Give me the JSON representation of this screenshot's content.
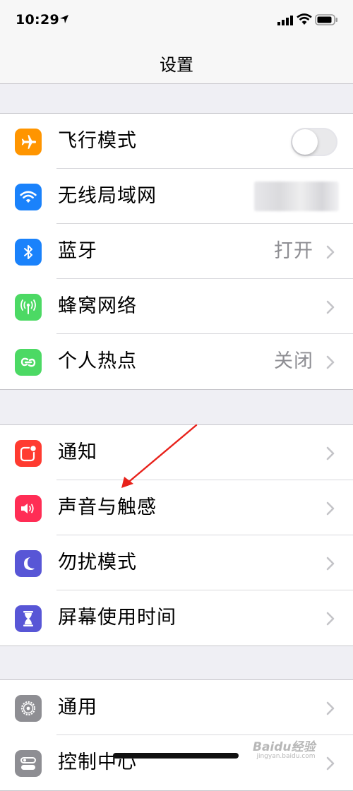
{
  "status_bar": {
    "time": "10:29",
    "icons": [
      "location-arrow-icon",
      "cellular-signal-icon",
      "wifi-icon",
      "battery-icon"
    ]
  },
  "nav": {
    "title": "设置"
  },
  "groups": [
    {
      "rows": [
        {
          "label": "飞行模式",
          "icon": "airplane-icon",
          "color": "#ff9500",
          "accessory": "toggle",
          "toggle_on": false
        },
        {
          "label": "无线局域网",
          "icon": "wifi-icon",
          "color": "#1a82fb",
          "accessory": "blurred-value"
        },
        {
          "label": "蓝牙",
          "icon": "bluetooth-icon",
          "color": "#1a82fb",
          "value": "打开",
          "accessory": "chevron"
        },
        {
          "label": "蜂窝网络",
          "icon": "cellular-antenna-icon",
          "color": "#4cd964",
          "accessory": "chevron"
        },
        {
          "label": "个人热点",
          "icon": "hotspot-icon",
          "color": "#4cd964",
          "value": "关闭",
          "accessory": "chevron"
        }
      ]
    },
    {
      "rows": [
        {
          "label": "通知",
          "icon": "notifications-icon",
          "color": "#ff3b30",
          "accessory": "chevron"
        },
        {
          "label": "声音与触感",
          "icon": "speaker-icon",
          "color": "#ff2d55",
          "accessory": "chevron"
        },
        {
          "label": "勿扰模式",
          "icon": "moon-icon",
          "color": "#5856d6",
          "accessory": "chevron"
        },
        {
          "label": "屏幕使用时间",
          "icon": "hourglass-icon",
          "color": "#5856d6",
          "accessory": "chevron"
        }
      ]
    },
    {
      "rows": [
        {
          "label": "通用",
          "icon": "gear-icon",
          "color": "#8e8e93",
          "accessory": "chevron"
        },
        {
          "label": "控制中心",
          "icon": "control-center-icon",
          "color": "#8e8e93",
          "accessory": "chevron"
        }
      ]
    }
  ],
  "annotation": {
    "arrow_color": "#e8221b",
    "points_to": "声音与触感"
  },
  "watermark": {
    "text": "Baidu经验",
    "sub": "jingyan.baidu.com"
  }
}
